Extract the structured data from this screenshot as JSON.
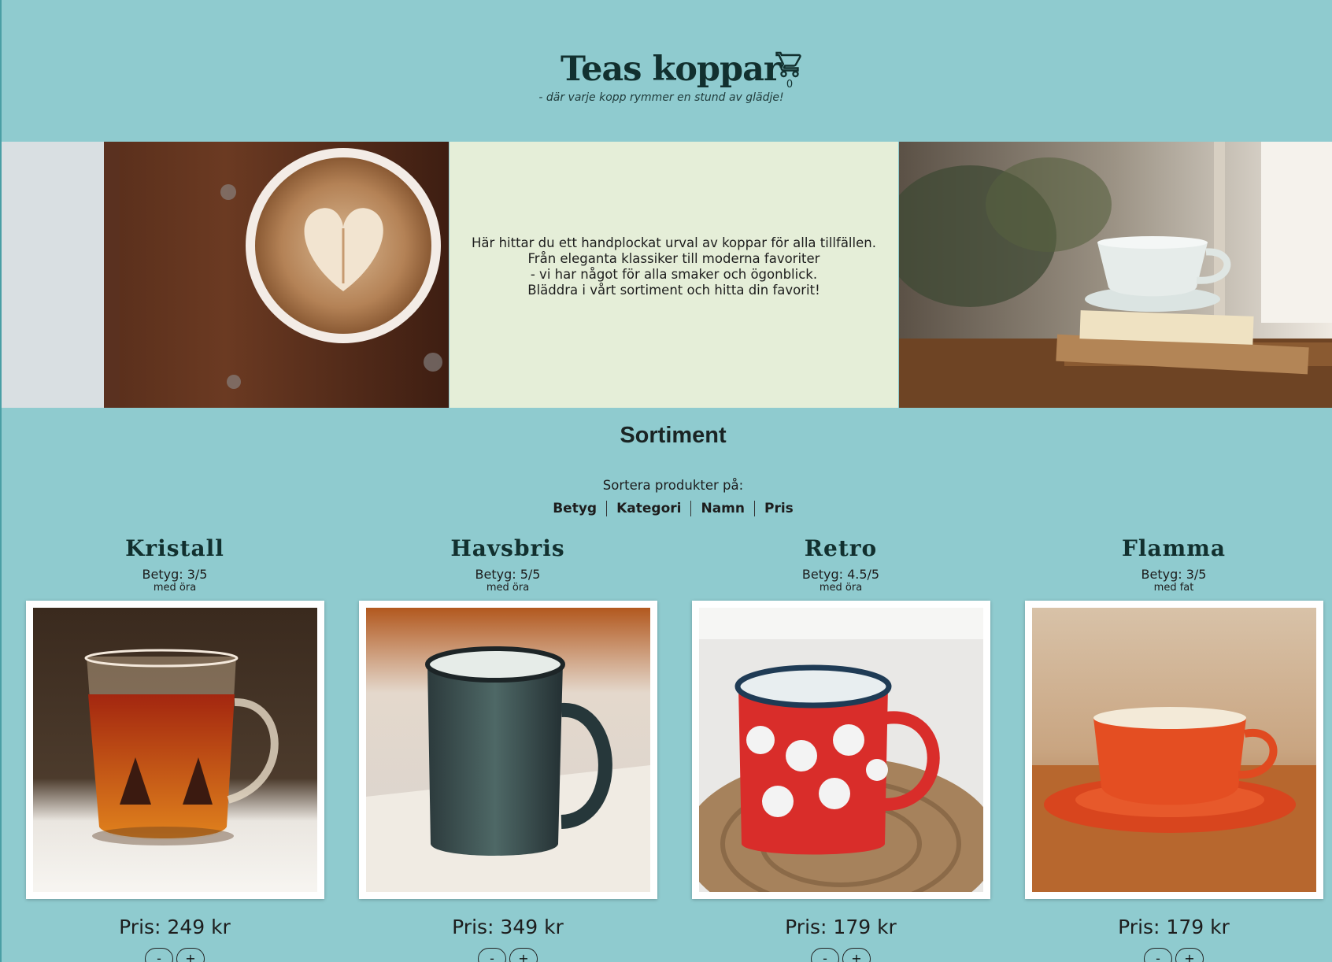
{
  "header": {
    "title": "Teas koppar",
    "cart_count": "0",
    "tagline": "- där varje kopp rymmer en stund av glädje!"
  },
  "icons": {
    "cart": "shopping-cart-icon"
  },
  "hero": {
    "lines": [
      "Här hittar du ett handplockat urval av koppar för alla tillfällen.",
      "Från eleganta klassiker till moderna favoriter",
      "- vi har något för alla smaker och ögonblick.",
      "Bläddra i vårt sortiment och hitta din favorit!"
    ]
  },
  "sortiment": {
    "title": "Sortiment",
    "sort_label": "Sortera produkter på:",
    "sort_options": [
      "Betyg",
      "Kategori",
      "Namn",
      "Pris"
    ]
  },
  "products": [
    {
      "name": "Kristall",
      "rating": "Betyg: 3/5",
      "variant": "med öra",
      "price": "Pris: 249 kr",
      "minus": "-",
      "plus": "+"
    },
    {
      "name": "Havsbris",
      "rating": "Betyg: 5/5",
      "variant": "med öra",
      "price": "Pris: 349 kr",
      "minus": "-",
      "plus": "+"
    },
    {
      "name": "Retro",
      "rating": "Betyg: 4.5/5",
      "variant": "med öra",
      "price": "Pris: 179 kr",
      "minus": "-",
      "plus": "+"
    },
    {
      "name": "Flamma",
      "rating": "Betyg: 3/5",
      "variant": "med fat",
      "price": "Pris: 179 kr",
      "minus": "-",
      "plus": "+"
    }
  ],
  "colors": {
    "background": "#8fcbcf",
    "hero_panel": "#e5eed8",
    "title": "#12302f"
  }
}
